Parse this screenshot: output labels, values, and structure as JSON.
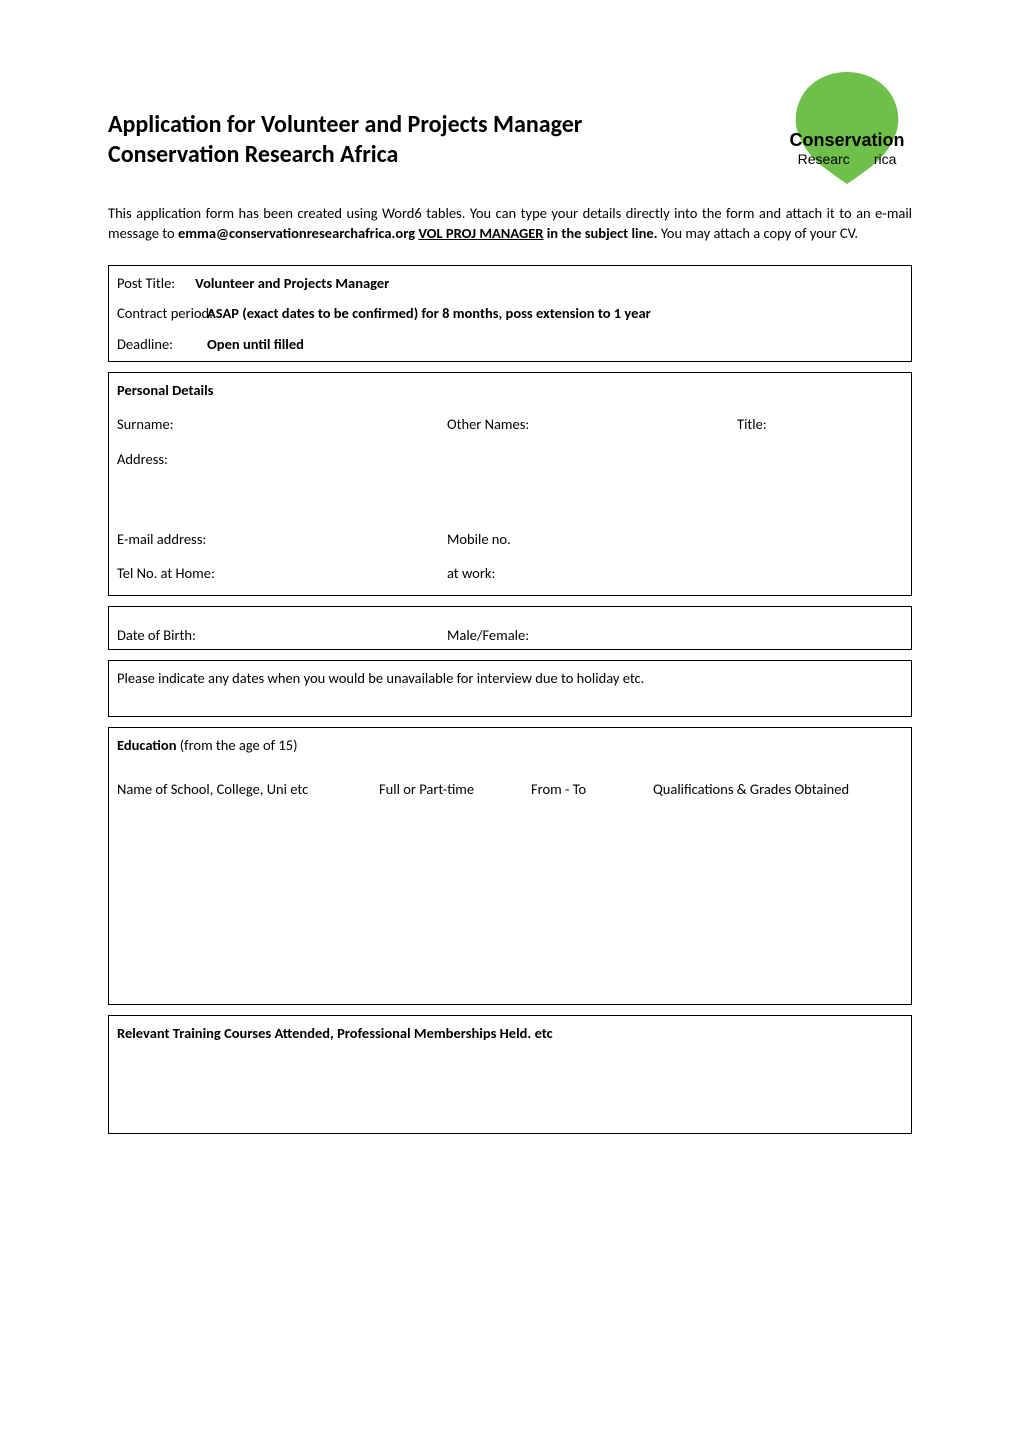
{
  "header": {
    "title_line1": "Application for Volunteer and Projects Manager",
    "title_line2": "Conservation Research Africa"
  },
  "logo": {
    "top": "Conservation",
    "bottom": "Research Africa"
  },
  "intro": {
    "text1": "This application form has been created using Word6 tables.  You can type your details directly into the form and attach it to an e-mail message to ",
    "email": "emma@conservationresearchafrica.org",
    "subject_hint": "VOL PROJ MANAGER",
    "text2": " in the subject line. ",
    "text3": "You may attach a copy of your CV."
  },
  "post": {
    "title_label": "Post Title:",
    "title_value": "Volunteer and Projects Manager",
    "contract_label": "Contract period:",
    "contract_value": "ASAP (exact dates to be confirmed) for 8 months, poss extension to 1 year",
    "deadline_label": "Deadline:",
    "deadline_value": "Open until filled"
  },
  "personal": {
    "section_title": "Personal Details",
    "surname_label": "Surname:",
    "other_names_label": "Other Names:",
    "title_label": "Title:",
    "address_label": "Address:",
    "email_label": "E-mail address:",
    "mobile_label": "Mobile no.",
    "home_tel_label": "Tel No. at Home:",
    "work_tel_label": "at work:"
  },
  "dob": {
    "dob_label": "Date of Birth:",
    "gender_label": "Male/Female:"
  },
  "availability": {
    "text": "Please indicate any dates when you would be unavailable for interview due to holiday etc."
  },
  "education": {
    "section_title": "Education",
    "section_title_suffix": " (from the age of 15)",
    "col1": "Name of School, College, Uni etc",
    "col2": "Full or Part-time",
    "col3": "From  -  To",
    "col4": "Qualifications & Grades Obtained"
  },
  "training": {
    "section_title": "Relevant Training Courses Attended, Professional Memberships Held. etc"
  }
}
